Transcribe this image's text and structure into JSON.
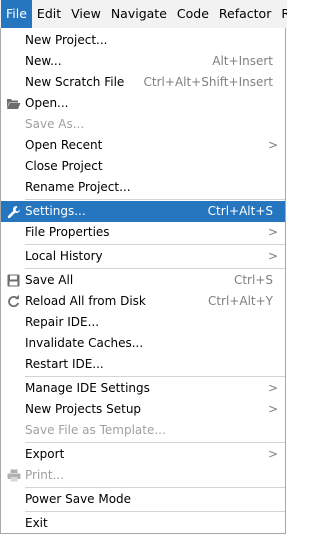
{
  "menubar": {
    "items": [
      "File",
      "Edit",
      "View",
      "Navigate",
      "Code",
      "Refactor",
      "R"
    ]
  },
  "menu": {
    "new_project": "New Project...",
    "new": "New...",
    "new_shortcut": "Alt+Insert",
    "new_scratch": "New Scratch File",
    "new_scratch_shortcut": "Ctrl+Alt+Shift+Insert",
    "open": "Open...",
    "save_as": "Save As...",
    "open_recent": "Open Recent",
    "close_project": "Close Project",
    "rename_project": "Rename Project...",
    "settings": "Settings...",
    "settings_shortcut": "Ctrl+Alt+S",
    "file_properties": "File Properties",
    "local_history": "Local History",
    "save_all": "Save All",
    "save_all_shortcut": "Ctrl+S",
    "reload_all": "Reload All from Disk",
    "reload_all_shortcut": "Ctrl+Alt+Y",
    "repair_ide": "Repair IDE...",
    "invalidate_caches": "Invalidate Caches...",
    "restart_ide": "Restart IDE...",
    "manage_ide_settings": "Manage IDE Settings",
    "new_projects_setup": "New Projects Setup",
    "save_as_template": "Save File as Template...",
    "export": "Export",
    "print": "Print...",
    "power_save": "Power Save Mode",
    "exit": "Exit",
    "submenu_arrow": ">"
  },
  "colors": {
    "accent": "#2675bf",
    "disabled": "#a0a0a0",
    "shortcut": "#808080"
  },
  "icons": {
    "open": "folder-open-icon",
    "settings": "wrench-icon",
    "save_all": "floppy-disk-icon",
    "reload": "refresh-icon",
    "print": "printer-icon"
  }
}
